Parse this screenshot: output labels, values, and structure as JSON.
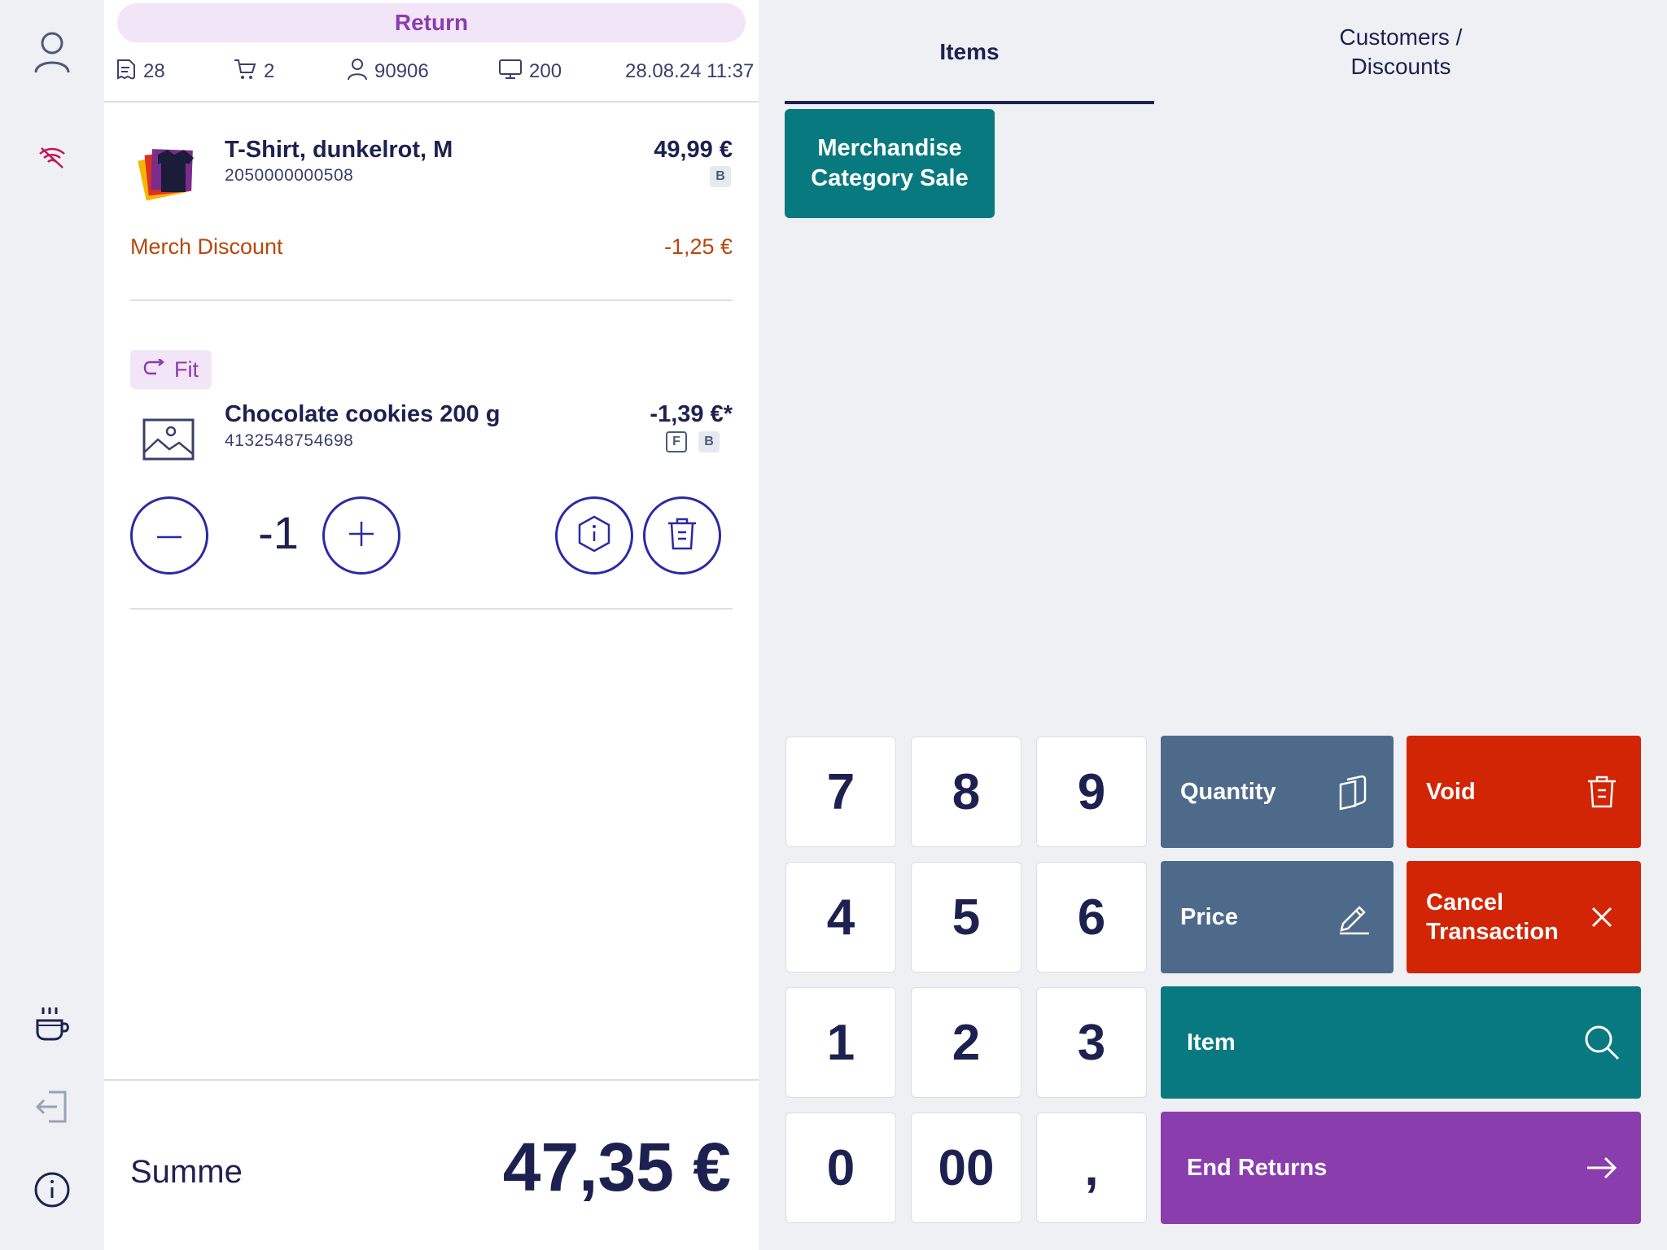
{
  "colors": {
    "accent_purple": "#8a3dad",
    "teal": "#087a7f",
    "slate": "#4e6a8a",
    "danger_red": "#d22506",
    "navy_text": "#1d2150",
    "discount_orange": "#b8470b"
  },
  "header": {
    "mode_label": "Return",
    "receipt_number": "28",
    "cart_count": "2",
    "user_id": "90906",
    "terminal_id": "200",
    "datetime": "28.08.24 11:37"
  },
  "sidebar": {
    "icons": [
      "user-icon",
      "wifi-off-icon",
      "coffee-break-icon",
      "logout-icon",
      "info-icon"
    ]
  },
  "lines": [
    {
      "title": "T-Shirt, dunkelrot, M",
      "code": "2050000000508",
      "price": "49,99 €",
      "tax_badges": [
        "B"
      ],
      "discount_label": "Merch Discount",
      "discount_value": "-1,25 €"
    },
    {
      "tag": "Fit",
      "title": "Chocolate cookies 200 g",
      "code": "4132548754698",
      "price": "-1,39 €*",
      "tax_badges": [
        "F",
        "B"
      ],
      "quantity": "-1"
    }
  ],
  "summary": {
    "label": "Summe",
    "total": "47,35 €"
  },
  "tabs": {
    "items": "Items",
    "customers_line1": "Customers /",
    "customers_line2": "Discounts"
  },
  "quick_buttons": {
    "merch_line1": "Merchandise",
    "merch_line2": "Category Sale"
  },
  "keypad": [
    "7",
    "8",
    "9",
    "4",
    "5",
    "6",
    "1",
    "2",
    "3",
    "0",
    "00",
    ","
  ],
  "actions": {
    "quantity": "Quantity",
    "void": "Void",
    "price": "Price",
    "cancel_line1": "Cancel",
    "cancel_line2": "Transaction",
    "item": "Item",
    "end_returns": "End Returns"
  }
}
